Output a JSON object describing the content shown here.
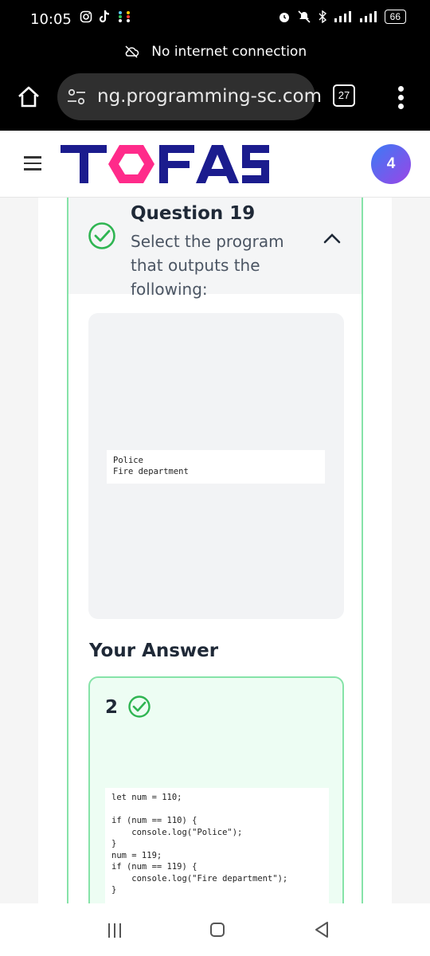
{
  "status_bar": {
    "time": "10:05",
    "battery": "66"
  },
  "network_banner": {
    "text": "No internet connection"
  },
  "browser": {
    "url": "ng.programming-sc.com",
    "tab_count": "27"
  },
  "site": {
    "logo": "TOFAS",
    "avatar_count": "4",
    "colors": {
      "logo_navy": "#1b1c8e",
      "logo_pink": "#ff2b8a",
      "success_green": "#34c759"
    }
  },
  "question": {
    "title": "Question 19",
    "prompt": "Select the program that outputs the following:",
    "output": "Police\nFire department"
  },
  "answer": {
    "heading": "Your Answer",
    "number": "2",
    "code": "let num = 110;\n\nif (num == 110) {\n    console.log(\"Police\");\n}\nnum = 119;\nif (num == 119) {\n    console.log(\"Fire department\");\n}"
  }
}
